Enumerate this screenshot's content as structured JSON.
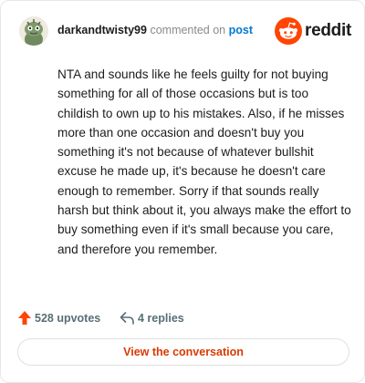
{
  "header": {
    "author": "darkandtwisty99",
    "action": "commented on",
    "link": "post",
    "brand": "reddit"
  },
  "comment": {
    "text": "NTA and sounds like he feels guilty for not buying something for all of those occasions but is too childish to own up to his mistakes. Also, if he misses more than one occasion and doesn't buy you something it's not because of whatever bullshit excuse he made up, it's because he doesn't care enough to remember. Sorry if that sounds really harsh but think about it, you always make the effort to buy something even if it's small because you care, and therefore you remember."
  },
  "footer": {
    "upvotes": "528 upvotes",
    "replies": "4 replies"
  },
  "cta": {
    "label": "View the conversation"
  },
  "colors": {
    "brand_orange": "#ff4500",
    "link_blue": "#0079d3",
    "cta_text": "#d93a00",
    "muted": "#576f76"
  },
  "icons": {
    "avatar": "snoo-avatar",
    "brand_logo": "reddit-logo-icon",
    "upvote": "upvote-arrow-icon",
    "reply": "reply-arrow-icon"
  }
}
